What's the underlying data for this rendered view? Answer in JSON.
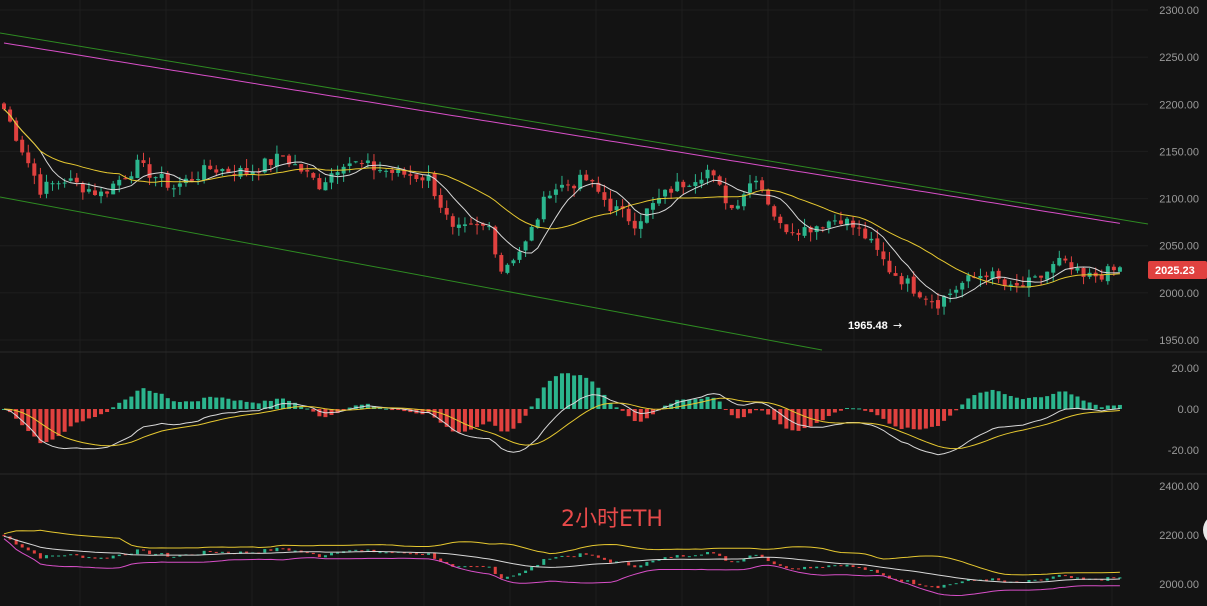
{
  "chart_data": {
    "type": "candlestick",
    "symbol": "ETH",
    "watermark": "2小时ETH",
    "price_axis": {
      "ticks": [
        "2300.00",
        "2250.00",
        "2200.00",
        "2150.00",
        "2100.00",
        "2050.00",
        "2000.00",
        "1950.00"
      ],
      "range": [
        1942,
        2310
      ]
    },
    "macd_axis": {
      "ticks": [
        "20.00",
        "0.00",
        "-20.00"
      ],
      "range": [
        -30,
        24
      ]
    },
    "overview_axis": {
      "ticks": [
        "2400.00",
        "2200.00",
        "2000.00"
      ],
      "range": [
        1960,
        2420
      ]
    },
    "last_price": "2025.23",
    "low_marker": "1965.48",
    "anchors": [
      [
        0,
        2195
      ],
      [
        6,
        2110
      ],
      [
        10,
        2120
      ],
      [
        16,
        2105
      ],
      [
        22,
        2135
      ],
      [
        28,
        2112
      ],
      [
        34,
        2132
      ],
      [
        40,
        2128
      ],
      [
        46,
        2145
      ],
      [
        52,
        2115
      ],
      [
        56,
        2140
      ],
      [
        64,
        2128
      ],
      [
        70,
        2122
      ],
      [
        74,
        2065
      ],
      [
        80,
        2070
      ],
      [
        82,
        2025
      ],
      [
        86,
        2052
      ],
      [
        90,
        2110
      ],
      [
        96,
        2120
      ],
      [
        100,
        2092
      ],
      [
        104,
        2075
      ],
      [
        110,
        2110
      ],
      [
        116,
        2130
      ],
      [
        120,
        2090
      ],
      [
        124,
        2125
      ],
      [
        128,
        2070
      ],
      [
        132,
        2068
      ],
      [
        138,
        2080
      ],
      [
        142,
        2060
      ],
      [
        146,
        2025
      ],
      [
        150,
        2005
      ],
      [
        154,
        1990
      ],
      [
        158,
        2010
      ],
      [
        162,
        2022
      ],
      [
        166,
        2003
      ],
      [
        170,
        2012
      ],
      [
        174,
        2033
      ],
      [
        178,
        2015
      ],
      [
        184,
        2025
      ]
    ],
    "candle_count": 185,
    "ma_fast_color": "#d8d8d8",
    "ma_slow_color": "#e6c830",
    "ma_long_color": "#d84fc8",
    "channel_color": "#2e8b22",
    "up_color": "#2bb58d",
    "down_color": "#e0413f"
  }
}
